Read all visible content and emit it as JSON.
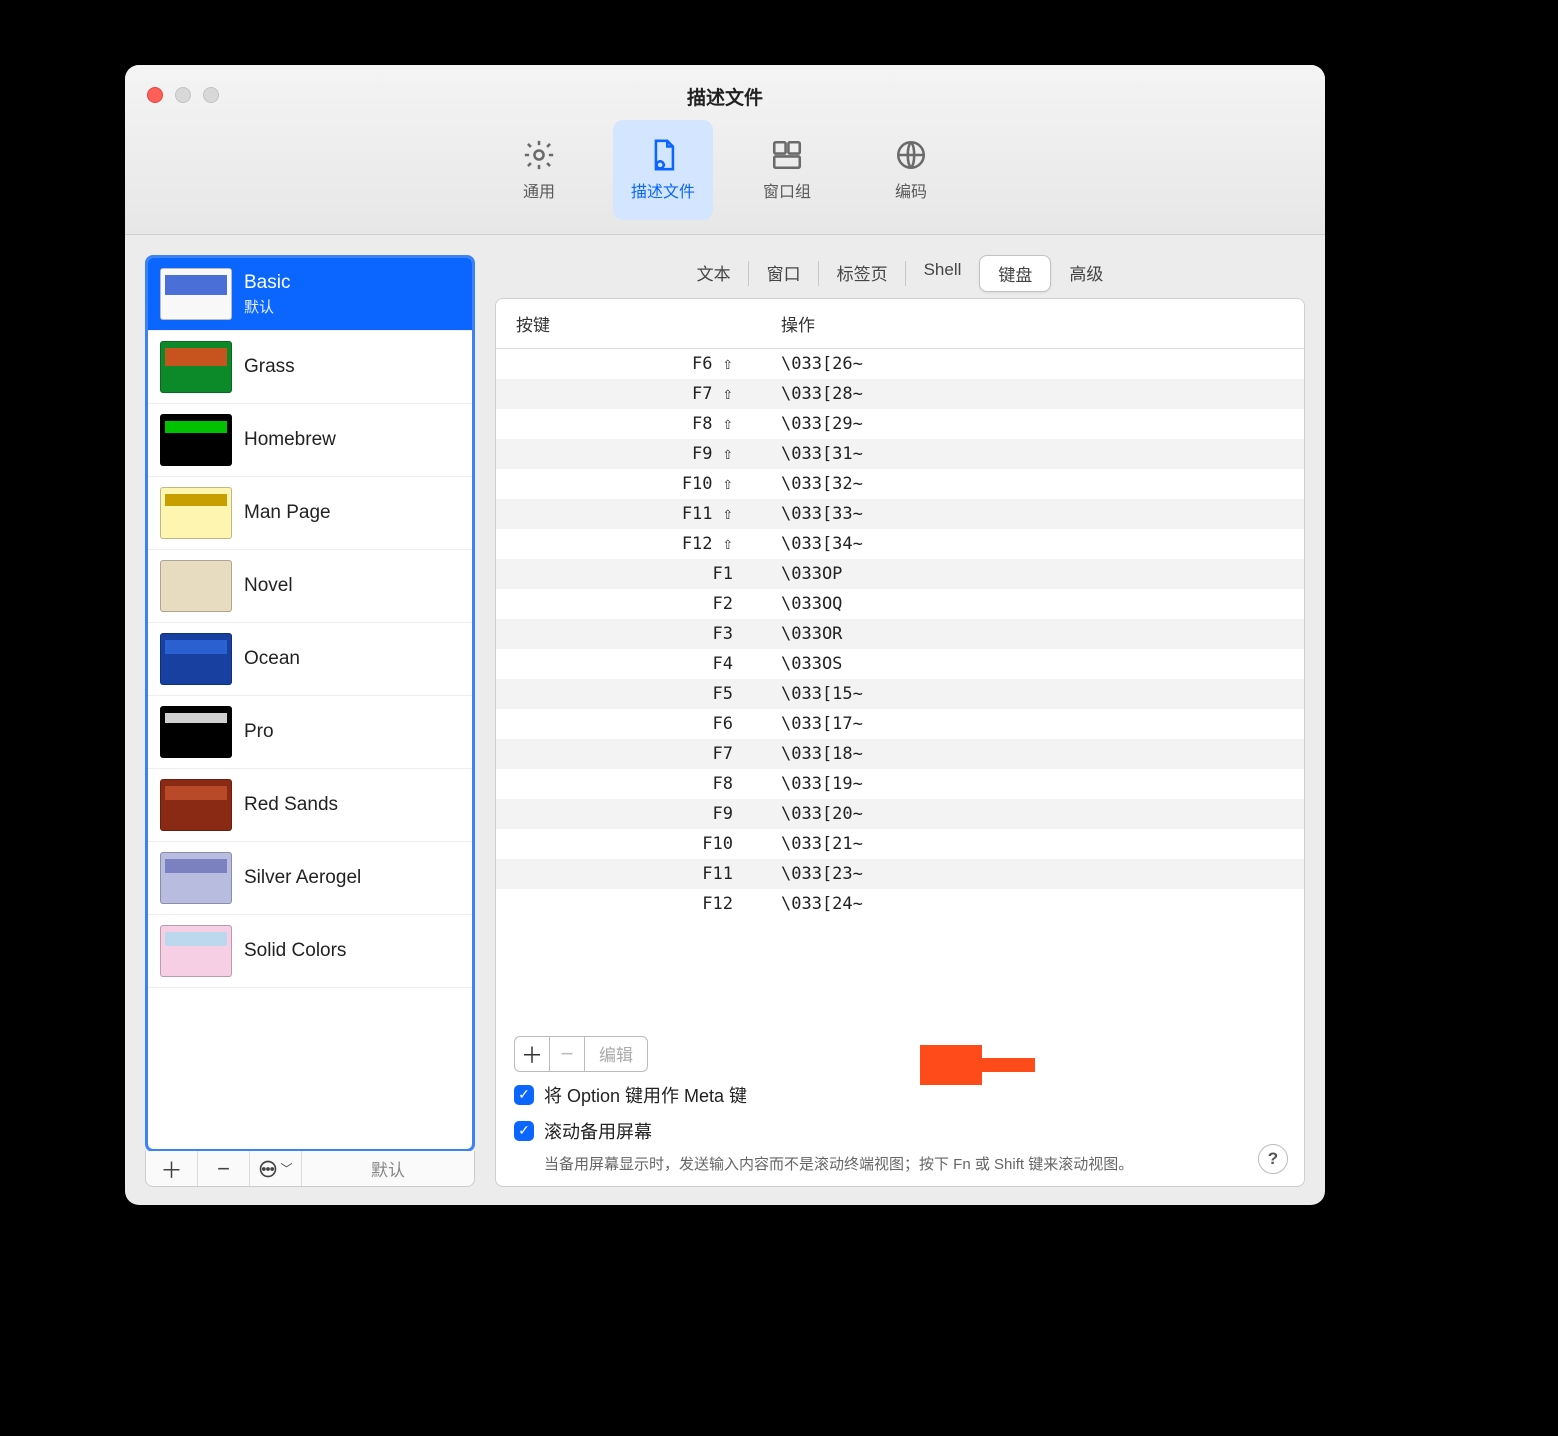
{
  "window": {
    "title": "描述文件"
  },
  "toolbar": {
    "general": "通用",
    "profiles": "描述文件",
    "windowGroups": "窗口组",
    "encoding": "编码",
    "activeIndex": 1
  },
  "profiles": {
    "items": [
      {
        "name": "Basic",
        "sub": "默认",
        "thumb": "basic",
        "selected": true
      },
      {
        "name": "Grass",
        "thumb": "grass"
      },
      {
        "name": "Homebrew",
        "thumb": "homebrew"
      },
      {
        "name": "Man Page",
        "thumb": "manpage"
      },
      {
        "name": "Novel",
        "thumb": "novel"
      },
      {
        "name": "Ocean",
        "thumb": "ocean"
      },
      {
        "name": "Pro",
        "thumb": "pro"
      },
      {
        "name": "Red Sands",
        "thumb": "redsands"
      },
      {
        "name": "Silver Aerogel",
        "thumb": "silver"
      },
      {
        "name": "Solid Colors",
        "thumb": "solid"
      }
    ],
    "defaultLabel": "默认"
  },
  "subtabs": {
    "items": [
      "文本",
      "窗口",
      "标签页",
      "Shell",
      "键盘",
      "高级"
    ],
    "activeIndex": 4
  },
  "table": {
    "headKey": "按键",
    "headAction": "操作",
    "rows": [
      {
        "key": "F6 ⇧",
        "action": "\\033[26~"
      },
      {
        "key": "F7 ⇧",
        "action": "\\033[28~"
      },
      {
        "key": "F8 ⇧",
        "action": "\\033[29~"
      },
      {
        "key": "F9 ⇧",
        "action": "\\033[31~"
      },
      {
        "key": "F10 ⇧",
        "action": "\\033[32~"
      },
      {
        "key": "F11 ⇧",
        "action": "\\033[33~"
      },
      {
        "key": "F12 ⇧",
        "action": "\\033[34~"
      },
      {
        "key": "F1",
        "action": "\\033OP"
      },
      {
        "key": "F2",
        "action": "\\033OQ"
      },
      {
        "key": "F3",
        "action": "\\033OR"
      },
      {
        "key": "F4",
        "action": "\\033OS"
      },
      {
        "key": "F5",
        "action": "\\033[15~"
      },
      {
        "key": "F6",
        "action": "\\033[17~"
      },
      {
        "key": "F7",
        "action": "\\033[18~"
      },
      {
        "key": "F8",
        "action": "\\033[19~"
      },
      {
        "key": "F9",
        "action": "\\033[20~"
      },
      {
        "key": "F10",
        "action": "\\033[21~"
      },
      {
        "key": "F11",
        "action": "\\033[23~"
      },
      {
        "key": "F12",
        "action": "\\033[24~"
      }
    ]
  },
  "controls": {
    "editLabel": "编辑",
    "optionMeta": "将 Option 键用作 Meta 键",
    "scrollAlt": "滚动备用屏幕",
    "hint": "当备用屏幕显示时，发送输入内容而不是滚动终端视图；按下 Fn 或 Shift 键来滚动视图。"
  },
  "annotation": {
    "arrowColor": "#ff4a1a"
  }
}
